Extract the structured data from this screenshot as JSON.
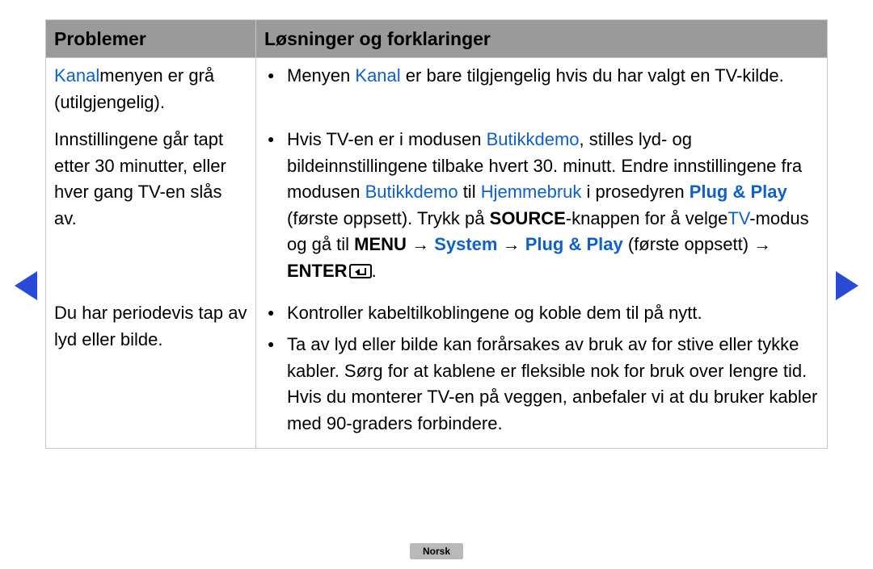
{
  "header": {
    "problems": "Problemer",
    "solutions": "Løsninger og forklaringer"
  },
  "rows": [
    {
      "problem": {
        "segments": [
          {
            "text": "Kanal",
            "cls": "kw"
          },
          {
            "text": "menyen er grå (utilgjengelig)."
          }
        ]
      },
      "solutions": [
        {
          "segments": [
            {
              "text": "Menyen "
            },
            {
              "text": "Kanal",
              "cls": "kw"
            },
            {
              "text": " er bare tilgjengelig hvis du har valgt en TV-kilde."
            }
          ]
        }
      ]
    },
    {
      "problem": {
        "segments": [
          {
            "text": "Innstillingene går tapt etter 30 minutter, eller hver gang TV-en slås av."
          }
        ]
      },
      "solutions": [
        {
          "segments": [
            {
              "text": "Hvis TV-en er i modusen "
            },
            {
              "text": "Butikkdemo",
              "cls": "kw"
            },
            {
              "text": ", stilles lyd- og bildeinnstillingene tilbake hvert 30. minutt. Endre innstillingene fra modusen "
            },
            {
              "text": "Butikkdemo",
              "cls": "kw"
            },
            {
              "text": " til "
            },
            {
              "text": "Hjemmebruk",
              "cls": "kw"
            },
            {
              "text": " i prosedyren "
            },
            {
              "text": "Plug & Play",
              "cls": "kw bold"
            },
            {
              "text": " (første oppsett). Trykk på "
            },
            {
              "text": "SOURCE",
              "cls": "bold"
            },
            {
              "text": "-knappen for å velge"
            },
            {
              "text": "TV",
              "cls": "kw"
            },
            {
              "text": "-modus og gå til "
            },
            {
              "text": "MENU",
              "cls": "bold"
            },
            {
              "text": " → "
            },
            {
              "text": "System",
              "cls": "kw bold"
            },
            {
              "text": " → "
            },
            {
              "text": "Plug & Play",
              "cls": "kw bold"
            },
            {
              "text": " (første oppsett) → "
            },
            {
              "text": "ENTER",
              "cls": "bold"
            },
            {
              "icon": "enter"
            },
            {
              "text": "."
            }
          ]
        }
      ]
    },
    {
      "problem": {
        "segments": [
          {
            "text": "Du har periodevis tap av lyd eller bilde."
          }
        ]
      },
      "solutions": [
        {
          "segments": [
            {
              "text": "Kontroller kabeltilkoblingene og koble dem til på nytt."
            }
          ]
        },
        {
          "segments": [
            {
              "text": "Ta av lyd eller bilde kan forårsakes av bruk av for stive eller tykke kabler. Sørg for at kablene er fleksible nok for bruk over lengre tid. Hvis du monterer TV-en på veggen, anbefaler vi at du bruker kabler med 90-graders forbindere."
            }
          ]
        }
      ]
    }
  ],
  "language_badge": "Norsk"
}
